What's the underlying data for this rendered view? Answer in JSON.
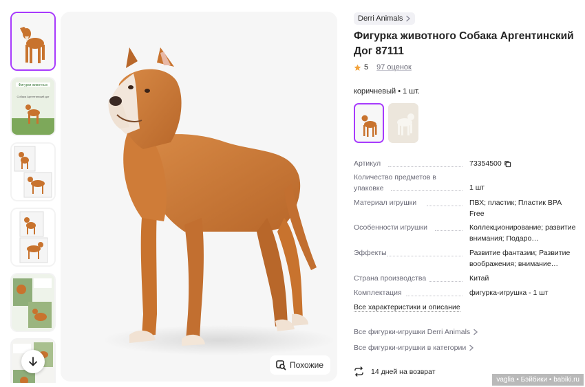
{
  "brand": {
    "label": "Derri Animals"
  },
  "product": {
    "title": "Фигурка животного Собака Аргентинский Дог 87111",
    "rating": "5",
    "reviews": "97 оценок",
    "variant_label": "коричневый • 1 шт."
  },
  "specs": [
    {
      "key": "Артикул",
      "value": "73354500"
    },
    {
      "key": "Количество предметов в упаковке",
      "value": "1 шт"
    },
    {
      "key": "Материал игрушки",
      "value": "ПВХ; пластик; Пластик BPA Free"
    },
    {
      "key": "Особенности игрушки",
      "value": "Коллекционирование; развитие внимания; Подаро…"
    },
    {
      "key": "Эффекты",
      "value": "Развитие фантазии; Развитие воображения; внимание…"
    },
    {
      "key": "Страна производства",
      "value": "Китай"
    },
    {
      "key": "Комплектация",
      "value": "фигурка-игрушка - 1 шт"
    }
  ],
  "links": {
    "all_specs": "Все характеристики и описание",
    "brand_all": "Все фигурки-игрушки Derri Animals",
    "category_all": "Все фигурки-игрушки в категории"
  },
  "returns": "14 дней на возврат",
  "similar_button": "Похожие",
  "thumb_texts": {
    "t2_title": "Фигурки животных",
    "t2_sub": "Собака Аргентинский дог"
  },
  "watermark": "vaglia • Бэйбики • babiki.ru",
  "colors": {
    "accent": "#a73afd",
    "star": "#f2a23a",
    "dog": "#c8732e"
  },
  "icons": [
    "chevron-right-icon",
    "star-icon",
    "copy-icon",
    "search-image-icon",
    "arrow-down-icon",
    "return-icon"
  ]
}
